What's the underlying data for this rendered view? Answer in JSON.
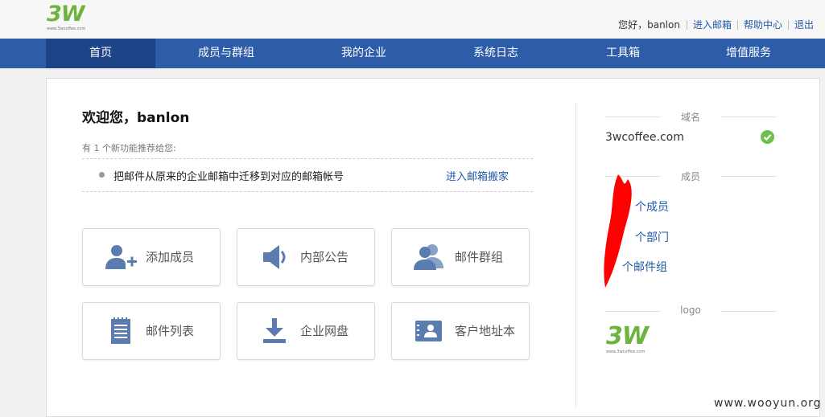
{
  "brand": {
    "logo_text": "3W",
    "logo_sub": "www.3wcoffee.com"
  },
  "userbar": {
    "greeting": "您好，banlon",
    "links": [
      "进入邮箱",
      "帮助中心",
      "退出"
    ]
  },
  "nav": {
    "items": [
      "首页",
      "成员与群组",
      "我的企业",
      "系统日志",
      "工具箱",
      "增值服务"
    ],
    "active_index": 0
  },
  "main": {
    "welcome": "欢迎您，banlon",
    "feature_count": "有 1 个新功能推荐给您:",
    "feature": {
      "text": "把邮件从原来的企业邮箱中迁移到对应的邮箱帐号",
      "link": "进入邮箱搬家"
    },
    "tiles": [
      {
        "label": "添加成员",
        "icon": "add-user-icon"
      },
      {
        "label": "内部公告",
        "icon": "speaker-icon"
      },
      {
        "label": "邮件群组",
        "icon": "group-icon"
      },
      {
        "label": "邮件列表",
        "icon": "list-icon"
      },
      {
        "label": "企业网盘",
        "icon": "download-icon"
      },
      {
        "label": "客户地址本",
        "icon": "contact-card-icon"
      }
    ]
  },
  "sidebar": {
    "domain_heading": "域名",
    "domain": "3wcoffee.com",
    "members_heading": "成员",
    "member_rows": [
      "个成员",
      "个部门",
      "个邮件组"
    ],
    "logo_heading": "logo"
  },
  "watermark": "www.wooyun.org",
  "colors": {
    "nav_bg": "#2d5da8",
    "nav_active": "#1d4486",
    "link": "#1f5aa8",
    "logo_green": "#6cb33f",
    "icon_blue": "#5b7cae"
  }
}
